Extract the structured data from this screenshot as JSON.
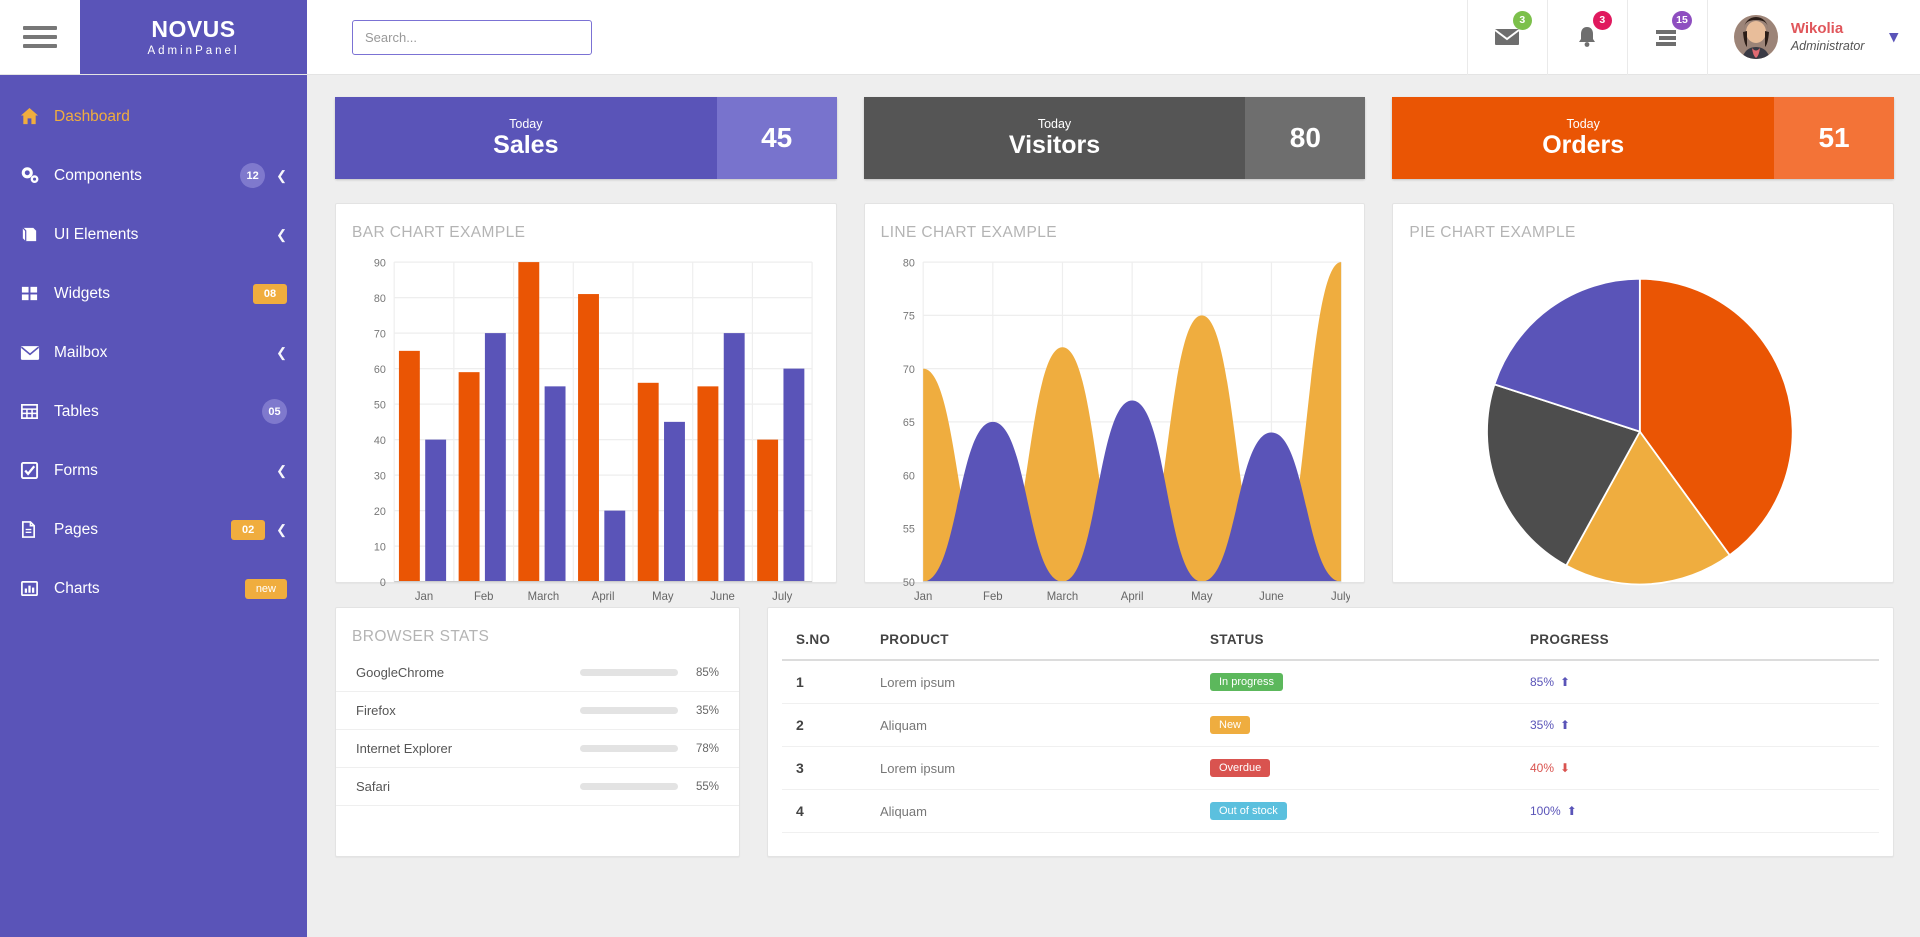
{
  "brand": {
    "title": "NOVUS",
    "subtitle": "AdminPanel"
  },
  "search": {
    "placeholder": "Search...",
    "value": ""
  },
  "header": {
    "icons": [
      {
        "name": "mail-icon",
        "glyph": "✉",
        "badge": "3",
        "badge_color": "#7cc04b"
      },
      {
        "name": "bell-icon",
        "glyph": "🔔",
        "badge": "3",
        "badge_color": "#e0195e"
      },
      {
        "name": "tasks-icon",
        "glyph": "☰",
        "badge": "15",
        "badge_color": "#8e4ec0"
      }
    ],
    "user": {
      "name": "Wikolia",
      "role": "Administrator",
      "chevron": "⌄"
    }
  },
  "sidebar": {
    "items": [
      {
        "label": "Dashboard",
        "icon": "home-icon",
        "glyph": "⌂",
        "badge": "",
        "badge_type": "",
        "chevron": false,
        "active": true
      },
      {
        "label": "Components",
        "icon": "cogs-icon",
        "glyph": "⚙",
        "badge": "12",
        "badge_type": "round",
        "chevron": true,
        "active": false
      },
      {
        "label": "UI Elements",
        "icon": "book-icon",
        "glyph": "◧",
        "badge": "",
        "badge_type": "",
        "chevron": true,
        "active": false
      },
      {
        "label": "Widgets",
        "icon": "grid-icon",
        "glyph": "▦",
        "badge": "08",
        "badge_type": "square",
        "chevron": false,
        "active": false
      },
      {
        "label": "Mailbox",
        "icon": "envelope-icon",
        "glyph": "✉",
        "badge": "",
        "badge_type": "",
        "chevron": true,
        "active": false
      },
      {
        "label": "Tables",
        "icon": "table-icon",
        "glyph": "▦",
        "badge": "05",
        "badge_type": "round",
        "chevron": false,
        "active": false
      },
      {
        "label": "Forms",
        "icon": "checkbox-icon",
        "glyph": "☑",
        "badge": "",
        "badge_type": "",
        "chevron": true,
        "active": false
      },
      {
        "label": "Pages",
        "icon": "file-icon",
        "glyph": "▤",
        "badge": "02",
        "badge_type": "square",
        "chevron": true,
        "active": false
      },
      {
        "label": "Charts",
        "icon": "bar-chart-icon",
        "glyph": "█",
        "badge": "new",
        "badge_type": "new",
        "chevron": false,
        "active": false
      }
    ]
  },
  "stats": [
    {
      "today": "Today",
      "label": "Sales",
      "value": "45",
      "color": "#5a54b8",
      "accent": "#7873cd"
    },
    {
      "today": "Today",
      "label": "Visitors",
      "value": "80",
      "color": "#555555",
      "accent": "#6e6e6e"
    },
    {
      "today": "Today",
      "label": "Orders",
      "value": "51",
      "color": "#ea5504",
      "accent": "#f37337"
    }
  ],
  "chart_data": [
    {
      "type": "bar",
      "title": "BAR CHART EXAMPLE",
      "categories": [
        "Jan",
        "Feb",
        "March",
        "April",
        "May",
        "June",
        "July"
      ],
      "series": [
        {
          "name": "series-orange",
          "color": "#ea5504",
          "values": [
            65,
            59,
            90,
            81,
            56,
            55,
            40
          ]
        },
        {
          "name": "series-purple",
          "color": "#5a54b8",
          "values": [
            40,
            70,
            55,
            20,
            45,
            70,
            60
          ]
        }
      ],
      "ylim": [
        0,
        90
      ],
      "yticks": [
        0,
        10,
        20,
        30,
        40,
        50,
        60,
        70,
        80,
        90
      ],
      "xlabel": "",
      "ylabel": "",
      "grid": true,
      "legend": "none"
    },
    {
      "type": "area",
      "title": "LINE CHART EXAMPLE",
      "categories": [
        "Jan",
        "Feb",
        "March",
        "April",
        "May",
        "June",
        "July"
      ],
      "series": [
        {
          "name": "series-yellow",
          "color": "#efad3f",
          "values": [
            70,
            50,
            72,
            50,
            75,
            50,
            80
          ]
        },
        {
          "name": "series-purple",
          "color": "#5a54b8",
          "values": [
            50,
            65,
            50,
            67,
            50,
            64,
            50
          ]
        }
      ],
      "ylim": [
        50,
        80
      ],
      "yticks": [
        50,
        55,
        60,
        65,
        70,
        75,
        80
      ],
      "xlabel": "",
      "ylabel": "",
      "grid": true,
      "legend": "none"
    },
    {
      "type": "pie",
      "title": "PIE CHART EXAMPLE",
      "labels": [
        "Orange",
        "Yellow",
        "Grey",
        "Purple"
      ],
      "values": [
        40,
        18,
        22,
        20
      ],
      "colors": [
        "#ea5504",
        "#efad3f",
        "#4d4d4d",
        "#5a54b8"
      ],
      "legend": "none"
    }
  ],
  "browser_stats": {
    "title": "BROWSER STATS",
    "rows": [
      {
        "name": "GoogleChrome",
        "percent": "85%",
        "value": 85,
        "color": "#5cb85c"
      },
      {
        "name": "Firefox",
        "percent": "35%",
        "value": 35,
        "color": "#efad3f"
      },
      {
        "name": "Internet Explorer",
        "percent": "78%",
        "value": 78,
        "color": "#d9534f"
      },
      {
        "name": "Safari",
        "percent": "55%",
        "value": 55,
        "color": "#5bc0de"
      }
    ]
  },
  "products_table": {
    "columns": [
      "S.NO",
      "PRODUCT",
      "STATUS",
      "PROGRESS"
    ],
    "rows": [
      {
        "no": "1",
        "product": "Lorem ipsum",
        "status": "In progress",
        "status_color": "#5cb85c",
        "progress": "85%",
        "trend": "up",
        "trend_color": "#5a54b8"
      },
      {
        "no": "2",
        "product": "Aliquam",
        "status": "New",
        "status_color": "#efad3f",
        "progress": "35%",
        "trend": "up",
        "trend_color": "#5a54b8"
      },
      {
        "no": "3",
        "product": "Lorem ipsum",
        "status": "Overdue",
        "status_color": "#d9534f",
        "progress": "40%",
        "trend": "down",
        "trend_color": "#d9534f"
      },
      {
        "no": "4",
        "product": "Aliquam",
        "status": "Out of stock",
        "status_color": "#5bc0de",
        "progress": "100%",
        "trend": "up",
        "trend_color": "#5a54b8"
      }
    ]
  }
}
